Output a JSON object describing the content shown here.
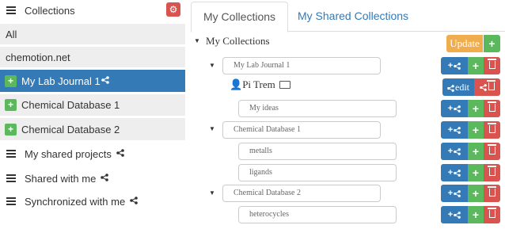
{
  "sidebar": {
    "collections_label": "Collections",
    "all_label": "All",
    "chemotion_label": "chemotion.net",
    "items": [
      {
        "label": "My Lab Journal 1",
        "active": true
      },
      {
        "label": "Chemical Database 1",
        "active": false
      },
      {
        "label": "Chemical Database 2",
        "active": false
      }
    ],
    "shared_projects_label": "My shared projects",
    "shared_with_me_label": "Shared with me",
    "synchronized_label": "Synchronized with me"
  },
  "tabs": {
    "my_collections": "My Collections",
    "my_shared_collections": "My Shared Collections"
  },
  "tree": {
    "root_label": "My Collections",
    "update_label": "Update",
    "edit_label": "edit",
    "owner_name": "Pi Trem",
    "nodes": [
      {
        "label": "My Lab Journal 1"
      },
      {
        "label": "My ideas"
      },
      {
        "label": "Chemical Database 1"
      },
      {
        "label": "metalls"
      },
      {
        "label": "ligands"
      },
      {
        "label": "Chemical Database 2"
      },
      {
        "label": "heterocycles"
      }
    ]
  },
  "colors": {
    "primary": "#337ab7",
    "success": "#5cb85c",
    "danger": "#d9534f",
    "warning": "#f0ad4e"
  }
}
